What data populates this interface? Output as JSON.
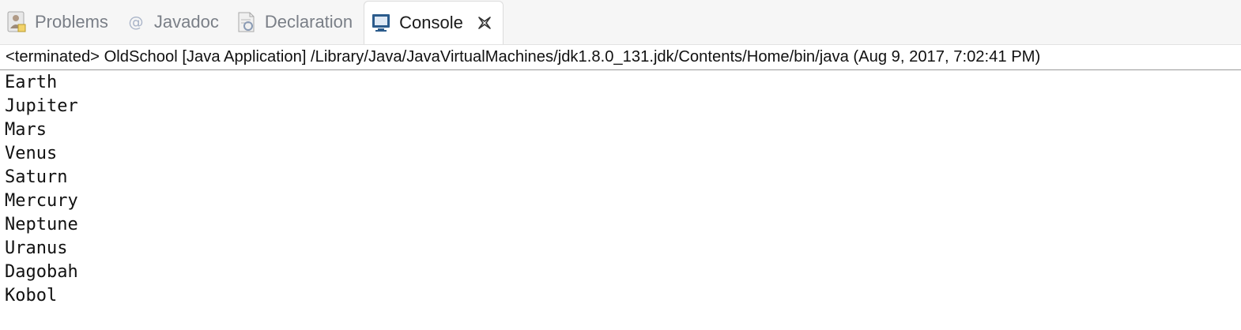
{
  "tabs": [
    {
      "label": "Problems",
      "icon": "problems-icon",
      "active": false
    },
    {
      "label": "Javadoc",
      "icon": "javadoc-at-icon",
      "active": false
    },
    {
      "label": "Declaration",
      "icon": "declaration-icon",
      "active": false
    },
    {
      "label": "Console",
      "icon": "console-icon",
      "active": true
    }
  ],
  "status": "<terminated> OldSchool [Java Application] /Library/Java/JavaVirtualMachines/jdk1.8.0_131.jdk/Contents/Home/bin/java (Aug 9, 2017, 7:02:41 PM)",
  "console_lines": [
    "Earth",
    "Jupiter",
    "Mars",
    "Venus",
    "Saturn",
    "Mercury",
    "Neptune",
    "Uranus",
    "Dagobah",
    "Kobol"
  ],
  "colors": {
    "tabbar_bg": "#f6f6f6",
    "inactive_tab_text": "#7a7f87",
    "console_icon": "#2b5b8c"
  }
}
